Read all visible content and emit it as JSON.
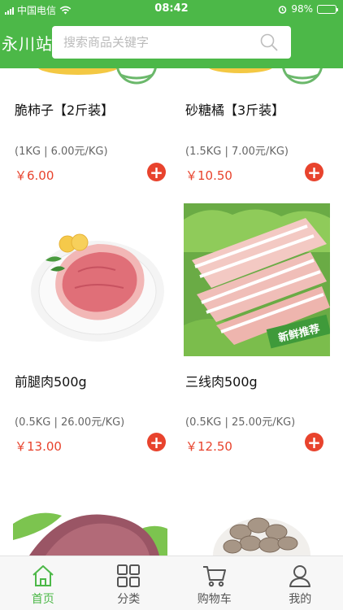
{
  "status_bar": {
    "carrier": "中国电信",
    "time": "08:42",
    "battery": "98%"
  },
  "header": {
    "brand": "永川站",
    "search_placeholder": "搜索商品关键字"
  },
  "products": [
    {
      "name": "脆柿子【2斤装】",
      "spec": "(1KG | 6.00元/KG)",
      "price": "￥6.00"
    },
    {
      "name": "砂糖橘【3斤装】",
      "spec": "(1.5KG | 7.00元/KG)",
      "price": "￥10.50"
    },
    {
      "name": "前腿肉500g",
      "spec": "(0.5KG | 26.00元/KG)",
      "price": "￥13.00"
    },
    {
      "name": "三线肉500g",
      "spec": "(0.5KG | 25.00元/KG)",
      "price": "￥12.50",
      "badge": "新鲜推荐"
    }
  ],
  "tabs": [
    {
      "label": "首页",
      "icon": "home-icon",
      "active": true
    },
    {
      "label": "分类",
      "icon": "category-grid-icon"
    },
    {
      "label": "购物车",
      "icon": "cart-icon"
    },
    {
      "label": "我的",
      "icon": "user-icon"
    }
  ],
  "colors": {
    "brand_green": "#4cb848",
    "price_red": "#e8432d"
  }
}
